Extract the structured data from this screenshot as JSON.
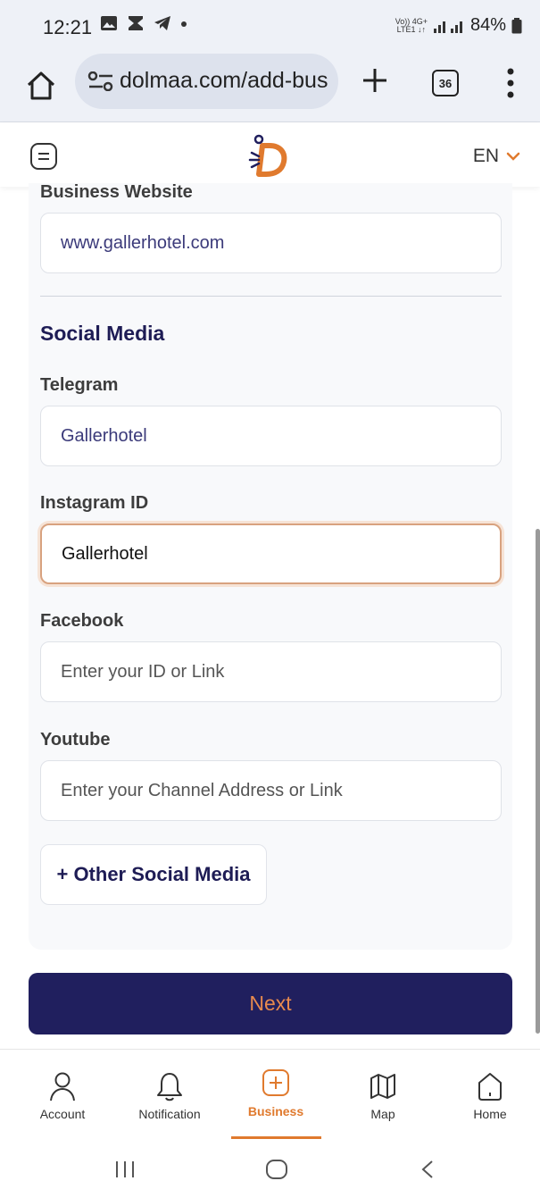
{
  "status_bar": {
    "time": "12:21",
    "network_top": "Vo)) 4G+",
    "network_bottom": "LTE1 ↓↑",
    "battery": "84%"
  },
  "browser": {
    "url": "dolmaa.com/add-bus",
    "tab_count": "36"
  },
  "header": {
    "language": "EN"
  },
  "form": {
    "website_label": "Business Website",
    "website_value": "www.gallerhotel.com",
    "social_title": "Social Media",
    "telegram_label": "Telegram",
    "telegram_value": "Gallerhotel",
    "instagram_label": "Instagram ID",
    "instagram_value": "Gallerhotel",
    "facebook_label": "Facebook",
    "facebook_placeholder": "Enter your ID or Link",
    "youtube_label": "Youtube",
    "youtube_placeholder": "Enter your Channel Address or Link",
    "other_social_label": "+ Other Social Media",
    "next_label": "Next"
  },
  "bottom_nav": {
    "items": [
      {
        "label": "Account",
        "icon": "person-icon"
      },
      {
        "label": "Notification",
        "icon": "bell-icon"
      },
      {
        "label": "Business",
        "icon": "plus-square-icon",
        "active": true
      },
      {
        "label": "Map",
        "icon": "map-icon"
      },
      {
        "label": "Home",
        "icon": "home-icon"
      }
    ]
  },
  "colors": {
    "primary": "#201f5e",
    "accent": "#e07a2e",
    "focus_border": "#d8a27f"
  }
}
